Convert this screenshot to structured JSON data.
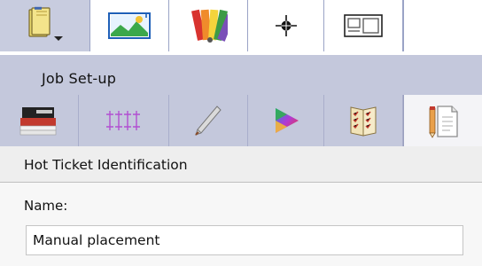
{
  "group": {
    "title": "Job Set-up"
  },
  "section": {
    "title": "Hot Ticket Identification",
    "name_label": "Name:",
    "name_value": "Manual placement"
  },
  "top_tabs": [
    {
      "icon": "open-book-icon"
    },
    {
      "icon": "image-icon"
    },
    {
      "icon": "color-swatches-icon"
    },
    {
      "icon": "crosshair-icon"
    },
    {
      "icon": "id-card-icon"
    }
  ],
  "tool_buttons": [
    {
      "icon": "media-stack-icon"
    },
    {
      "icon": "grid-marks-icon"
    },
    {
      "icon": "pen-icon"
    },
    {
      "icon": "color-triangle-icon"
    },
    {
      "icon": "checklist-book-icon"
    },
    {
      "icon": "document-pencil-icon"
    }
  ],
  "colors": {
    "band": "#c4c8dc",
    "active_tab": "#c8ccdf",
    "divider": "#9aa3c6"
  }
}
